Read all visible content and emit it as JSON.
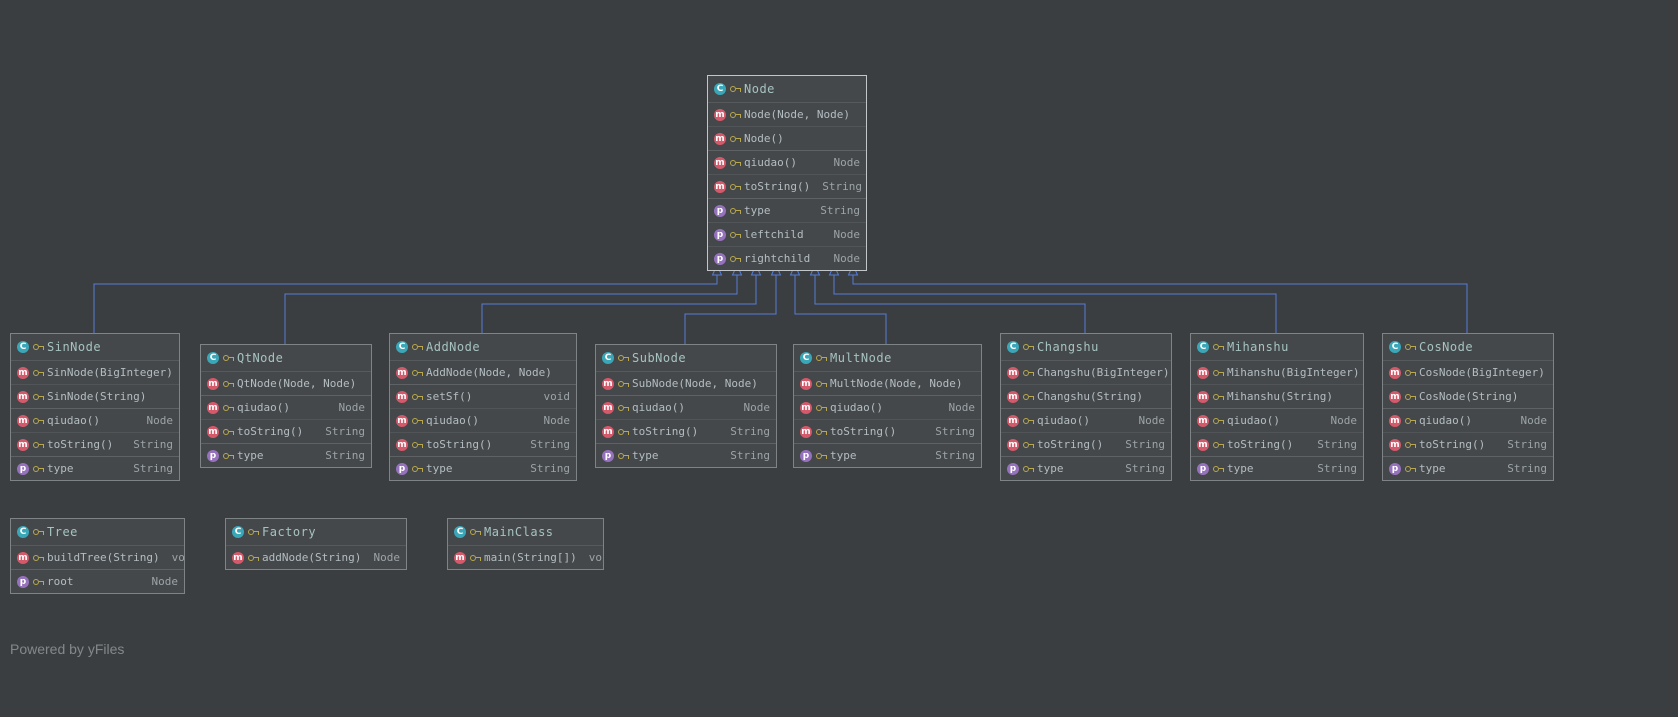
{
  "colors": {
    "canvas": "#3b3e40",
    "box_background": "#45484a",
    "box_border": "#7e8385",
    "selected_border": "#c2c6c8",
    "edge": "#557cd9",
    "class_icon": "#3aa7b8",
    "method_icon": "#d4596a",
    "field_icon": "#9672bd",
    "key_icon": "#b9a84e"
  },
  "glyphs": {
    "class": "C",
    "method": "m",
    "field": "p"
  },
  "footer": {
    "powered_by": "Powered by ",
    "brand": "yFiles"
  },
  "edges": [
    {
      "from": "SinNode",
      "to": "Node",
      "type": "inheritance"
    },
    {
      "from": "QtNode",
      "to": "Node",
      "type": "inheritance"
    },
    {
      "from": "AddNode",
      "to": "Node",
      "type": "inheritance"
    },
    {
      "from": "SubNode",
      "to": "Node",
      "type": "inheritance"
    },
    {
      "from": "MultNode",
      "to": "Node",
      "type": "inheritance"
    },
    {
      "from": "Changshu",
      "to": "Node",
      "type": "inheritance"
    },
    {
      "from": "Mihanshu",
      "to": "Node",
      "type": "inheritance"
    },
    {
      "from": "CosNode",
      "to": "Node",
      "type": "inheritance"
    }
  ],
  "classes": {
    "node": {
      "name": "Node",
      "members": [
        {
          "kind": "constructor",
          "label": "Node(Node, Node)",
          "type": ""
        },
        {
          "kind": "constructor",
          "label": "Node()",
          "type": ""
        },
        {
          "kind": "method",
          "label": "qiudao()",
          "type": "Node"
        },
        {
          "kind": "method",
          "label": "toString()",
          "type": "String"
        },
        {
          "kind": "field",
          "label": "type",
          "type": "String"
        },
        {
          "kind": "field",
          "label": "leftchild",
          "type": "Node"
        },
        {
          "kind": "field",
          "label": "rightchild",
          "type": "Node"
        }
      ]
    },
    "sinnode": {
      "name": "SinNode",
      "members": [
        {
          "kind": "constructor",
          "label": "SinNode(BigInteger)",
          "type": ""
        },
        {
          "kind": "constructor",
          "label": "SinNode(String)",
          "type": ""
        },
        {
          "kind": "method",
          "label": "qiudao()",
          "type": "Node"
        },
        {
          "kind": "method",
          "label": "toString()",
          "type": "String"
        },
        {
          "kind": "field",
          "label": "type",
          "type": "String"
        }
      ]
    },
    "qtnode": {
      "name": "QtNode",
      "members": [
        {
          "kind": "constructor",
          "label": "QtNode(Node, Node)",
          "type": ""
        },
        {
          "kind": "method",
          "label": "qiudao()",
          "type": "Node"
        },
        {
          "kind": "method",
          "label": "toString()",
          "type": "String"
        },
        {
          "kind": "field",
          "label": "type",
          "type": "String"
        }
      ]
    },
    "addnode": {
      "name": "AddNode",
      "members": [
        {
          "kind": "constructor",
          "label": "AddNode(Node, Node)",
          "type": ""
        },
        {
          "kind": "method",
          "label": "setSf()",
          "type": "void"
        },
        {
          "kind": "method",
          "label": "qiudao()",
          "type": "Node"
        },
        {
          "kind": "method",
          "label": "toString()",
          "type": "String"
        },
        {
          "kind": "field",
          "label": "type",
          "type": "String"
        }
      ]
    },
    "subnode": {
      "name": "SubNode",
      "members": [
        {
          "kind": "constructor",
          "label": "SubNode(Node, Node)",
          "type": ""
        },
        {
          "kind": "method",
          "label": "qiudao()",
          "type": "Node"
        },
        {
          "kind": "method",
          "label": "toString()",
          "type": "String"
        },
        {
          "kind": "field",
          "label": "type",
          "type": "String"
        }
      ]
    },
    "multnode": {
      "name": "MultNode",
      "members": [
        {
          "kind": "constructor",
          "label": "MultNode(Node, Node)",
          "type": ""
        },
        {
          "kind": "method",
          "label": "qiudao()",
          "type": "Node"
        },
        {
          "kind": "method",
          "label": "toString()",
          "type": "String"
        },
        {
          "kind": "field",
          "label": "type",
          "type": "String"
        }
      ]
    },
    "changshu": {
      "name": "Changshu",
      "members": [
        {
          "kind": "constructor",
          "label": "Changshu(BigInteger)",
          "type": ""
        },
        {
          "kind": "constructor",
          "label": "Changshu(String)",
          "type": ""
        },
        {
          "kind": "method",
          "label": "qiudao()",
          "type": "Node"
        },
        {
          "kind": "method",
          "label": "toString()",
          "type": "String"
        },
        {
          "kind": "field",
          "label": "type",
          "type": "String"
        }
      ]
    },
    "mihanshu": {
      "name": "Mihanshu",
      "members": [
        {
          "kind": "constructor",
          "label": "Mihanshu(BigInteger)",
          "type": ""
        },
        {
          "kind": "constructor",
          "label": "Mihanshu(String)",
          "type": ""
        },
        {
          "kind": "method",
          "label": "qiudao()",
          "type": "Node"
        },
        {
          "kind": "method",
          "label": "toString()",
          "type": "String"
        },
        {
          "kind": "field",
          "label": "type",
          "type": "String"
        }
      ]
    },
    "cosnode": {
      "name": "CosNode",
      "members": [
        {
          "kind": "constructor",
          "label": "CosNode(BigInteger)",
          "type": ""
        },
        {
          "kind": "constructor",
          "label": "CosNode(String)",
          "type": ""
        },
        {
          "kind": "method",
          "label": "qiudao()",
          "type": "Node"
        },
        {
          "kind": "method",
          "label": "toString()",
          "type": "String"
        },
        {
          "kind": "field",
          "label": "type",
          "type": "String"
        }
      ]
    },
    "tree": {
      "name": "Tree",
      "members": [
        {
          "kind": "method",
          "label": "buildTree(String)",
          "type": "void"
        },
        {
          "kind": "field",
          "label": "root",
          "type": "Node"
        }
      ]
    },
    "factory": {
      "name": "Factory",
      "members": [
        {
          "kind": "method",
          "label": "addNode(String)",
          "type": "Node"
        }
      ]
    },
    "mainclass": {
      "name": "MainClass",
      "members": [
        {
          "kind": "method",
          "label": "main(String[])",
          "type": "void"
        }
      ]
    }
  }
}
